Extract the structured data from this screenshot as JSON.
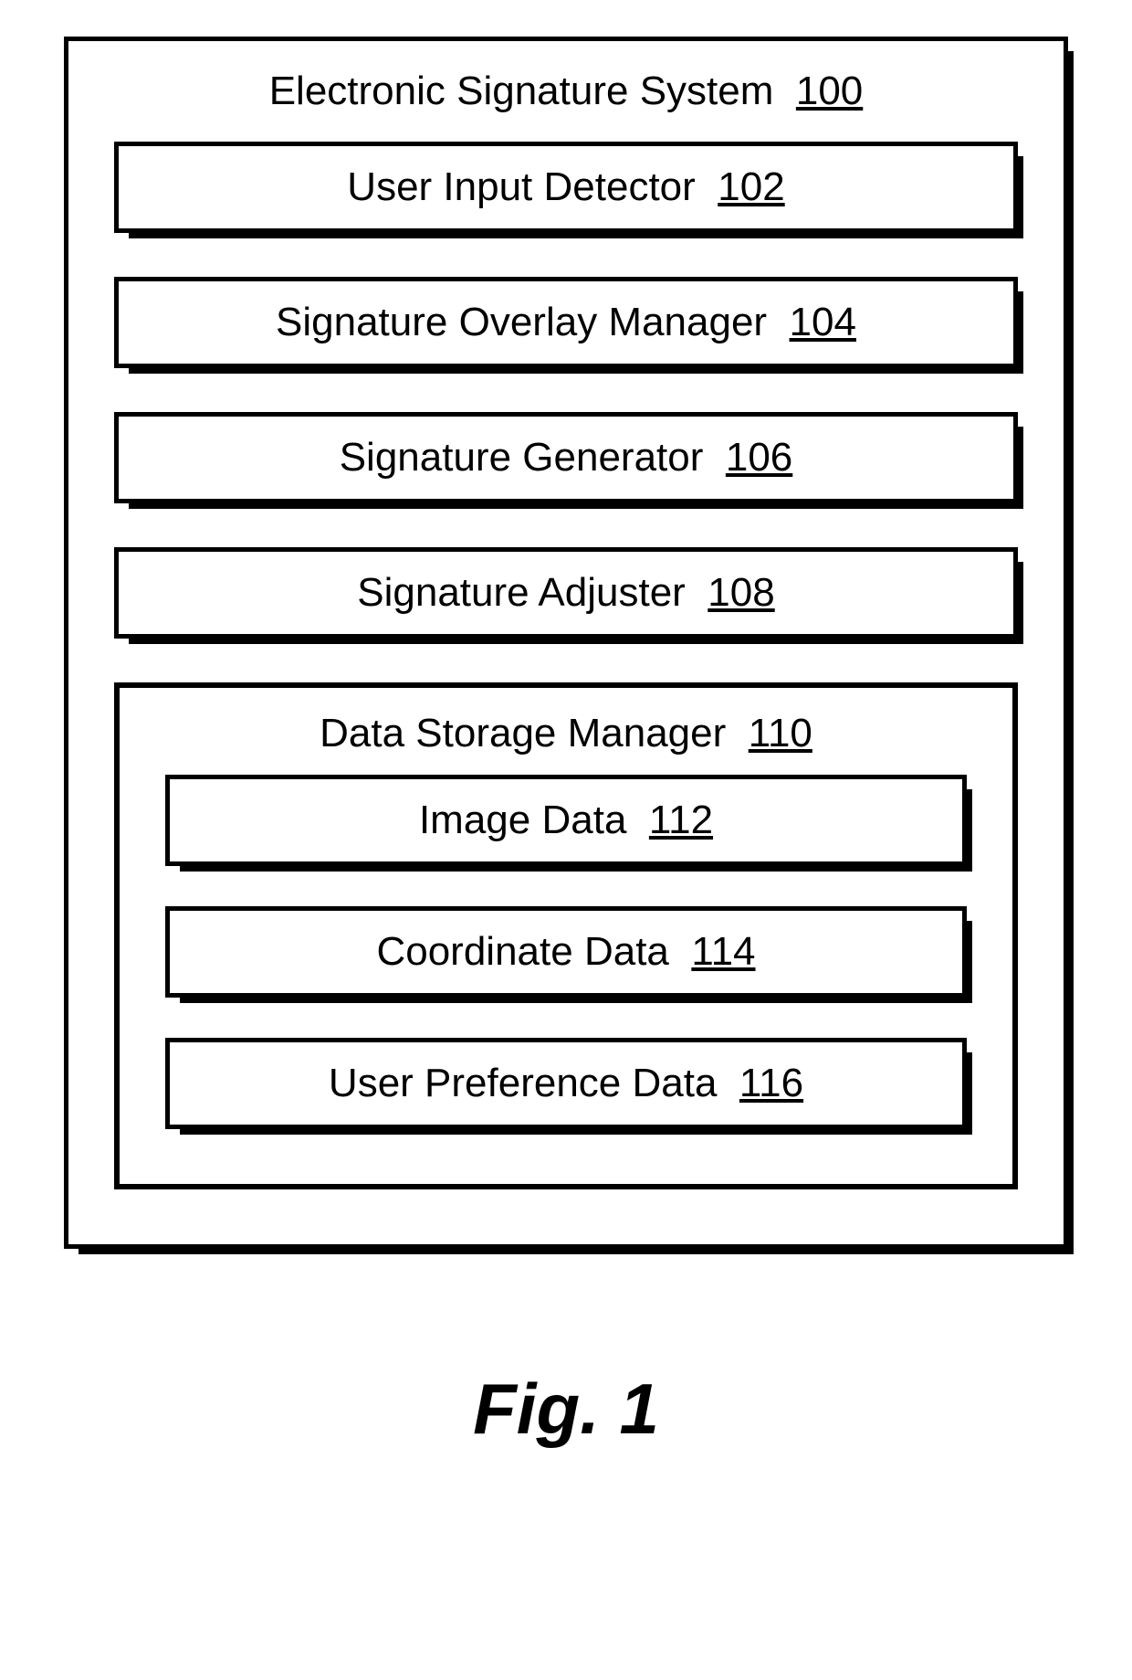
{
  "system": {
    "title_text": "Electronic Signature System",
    "title_ref": "100"
  },
  "modules": {
    "user_input_detector": {
      "label": "User Input Detector",
      "ref": "102"
    },
    "overlay_manager": {
      "label": "Signature Overlay Manager",
      "ref": "104"
    },
    "generator": {
      "label": "Signature Generator",
      "ref": "106"
    },
    "adjuster": {
      "label": "Signature Adjuster",
      "ref": "108"
    }
  },
  "storage": {
    "title": "Data Storage Manager",
    "ref": "110",
    "items": {
      "image_data": {
        "label": "Image Data",
        "ref": "112"
      },
      "coordinate_data": {
        "label": "Coordinate Data",
        "ref": "114"
      },
      "preference_data": {
        "label": "User Preference Data",
        "ref": "116"
      }
    }
  },
  "figure_caption": "Fig. 1"
}
